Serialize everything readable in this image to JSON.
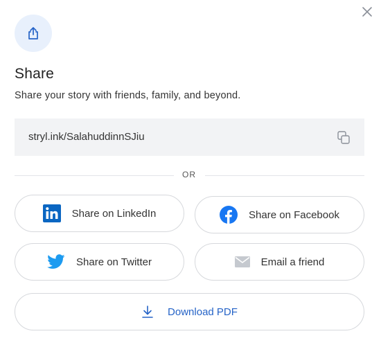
{
  "modal": {
    "title": "Share",
    "subtitle": "Share your story with friends, family, and beyond.",
    "close_icon": "close-icon",
    "header_icon": "share-icon"
  },
  "link": {
    "url": "stryl.ink/SalahuddinnSJiu",
    "copy_icon": "copy-icon"
  },
  "divider": {
    "label": "OR"
  },
  "buttons": {
    "linkedin": "Share on LinkedIn",
    "facebook": "Share on Facebook",
    "twitter": "Share on Twitter",
    "email": "Email a friend",
    "pdf": "Download PDF"
  },
  "colors": {
    "accent": "#2563c7",
    "linkedin": "#0a66c2",
    "facebook": "#1877f2",
    "twitter": "#1d9bf0",
    "email_icon": "#c5c9cf",
    "icon_circle_bg": "#e8f0fc",
    "link_box_bg": "#f2f3f5"
  }
}
